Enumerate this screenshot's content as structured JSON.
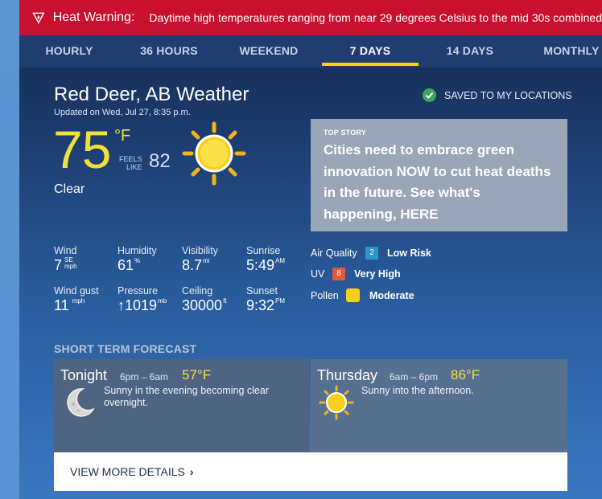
{
  "warning": {
    "title": "Heat Warning:",
    "text": "Daytime high temperatures ranging from near 29 degrees Celsius to the mid 30s combined"
  },
  "tabs": [
    {
      "label": "HOURLY",
      "active": false
    },
    {
      "label": "36 HOURS",
      "active": false
    },
    {
      "label": "WEEKEND",
      "active": false
    },
    {
      "label": "7 DAYS",
      "active": true
    },
    {
      "label": "14 DAYS",
      "active": false
    },
    {
      "label": "MONTHLY",
      "active": false
    }
  ],
  "location": {
    "title": "Red Deer, AB Weather",
    "updated": "Updated on Wed, Jul 27, 8:35 p.m.",
    "saved": "SAVED TO MY LOCATIONS"
  },
  "current": {
    "temp": "75",
    "unit": "°F",
    "feels_label_1": "FEELS",
    "feels_label_2": "LIKE",
    "feels_value": "82",
    "condition": "Clear",
    "icon": "sun-icon"
  },
  "top_story": {
    "kicker": "TOP STORY",
    "headline": "Cities need to embrace green innovation NOW to cut heat deaths in the future. See what's happening, HERE"
  },
  "metrics": {
    "wind": {
      "label": "Wind",
      "value": "7",
      "dir": "SE",
      "unit": "mph"
    },
    "humidity": {
      "label": "Humidity",
      "value": "61",
      "unit": "%"
    },
    "visibility": {
      "label": "Visibility",
      "value": "8.7",
      "unit": "mi"
    },
    "sunrise": {
      "label": "Sunrise",
      "value": "5:49",
      "unit": "AM"
    },
    "wind_gust": {
      "label": "Wind gust",
      "value": "11",
      "unit": "mph"
    },
    "pressure": {
      "label": "Pressure",
      "value": "↑1019",
      "unit": "mb"
    },
    "ceiling": {
      "label": "Ceiling",
      "value": "30000",
      "unit": "ft"
    },
    "sunset": {
      "label": "Sunset",
      "value": "9:32",
      "unit": "PM"
    }
  },
  "indices": {
    "air_quality": {
      "label": "Air Quality",
      "badge": "2",
      "level": "Low Risk",
      "color": "#2b96c9"
    },
    "uv": {
      "label": "UV",
      "badge": "8",
      "level": "Very High",
      "color": "#e35a3a"
    },
    "pollen": {
      "label": "Pollen",
      "level": "Moderate",
      "color": "#f5cf1d"
    }
  },
  "short_term": {
    "title": "SHORT TERM FORECAST",
    "periods": [
      {
        "day": "Tonight",
        "time": "6pm – 6am",
        "temp": "57°F",
        "desc": "Sunny in the evening becoming clear overnight.",
        "icon": "moon-icon"
      },
      {
        "day": "Thursday",
        "time": "6am – 6pm",
        "temp": "86°F",
        "desc": "Sunny into the afternoon.",
        "icon": "sun-icon"
      }
    ],
    "details": "VIEW MORE DETAILS"
  }
}
